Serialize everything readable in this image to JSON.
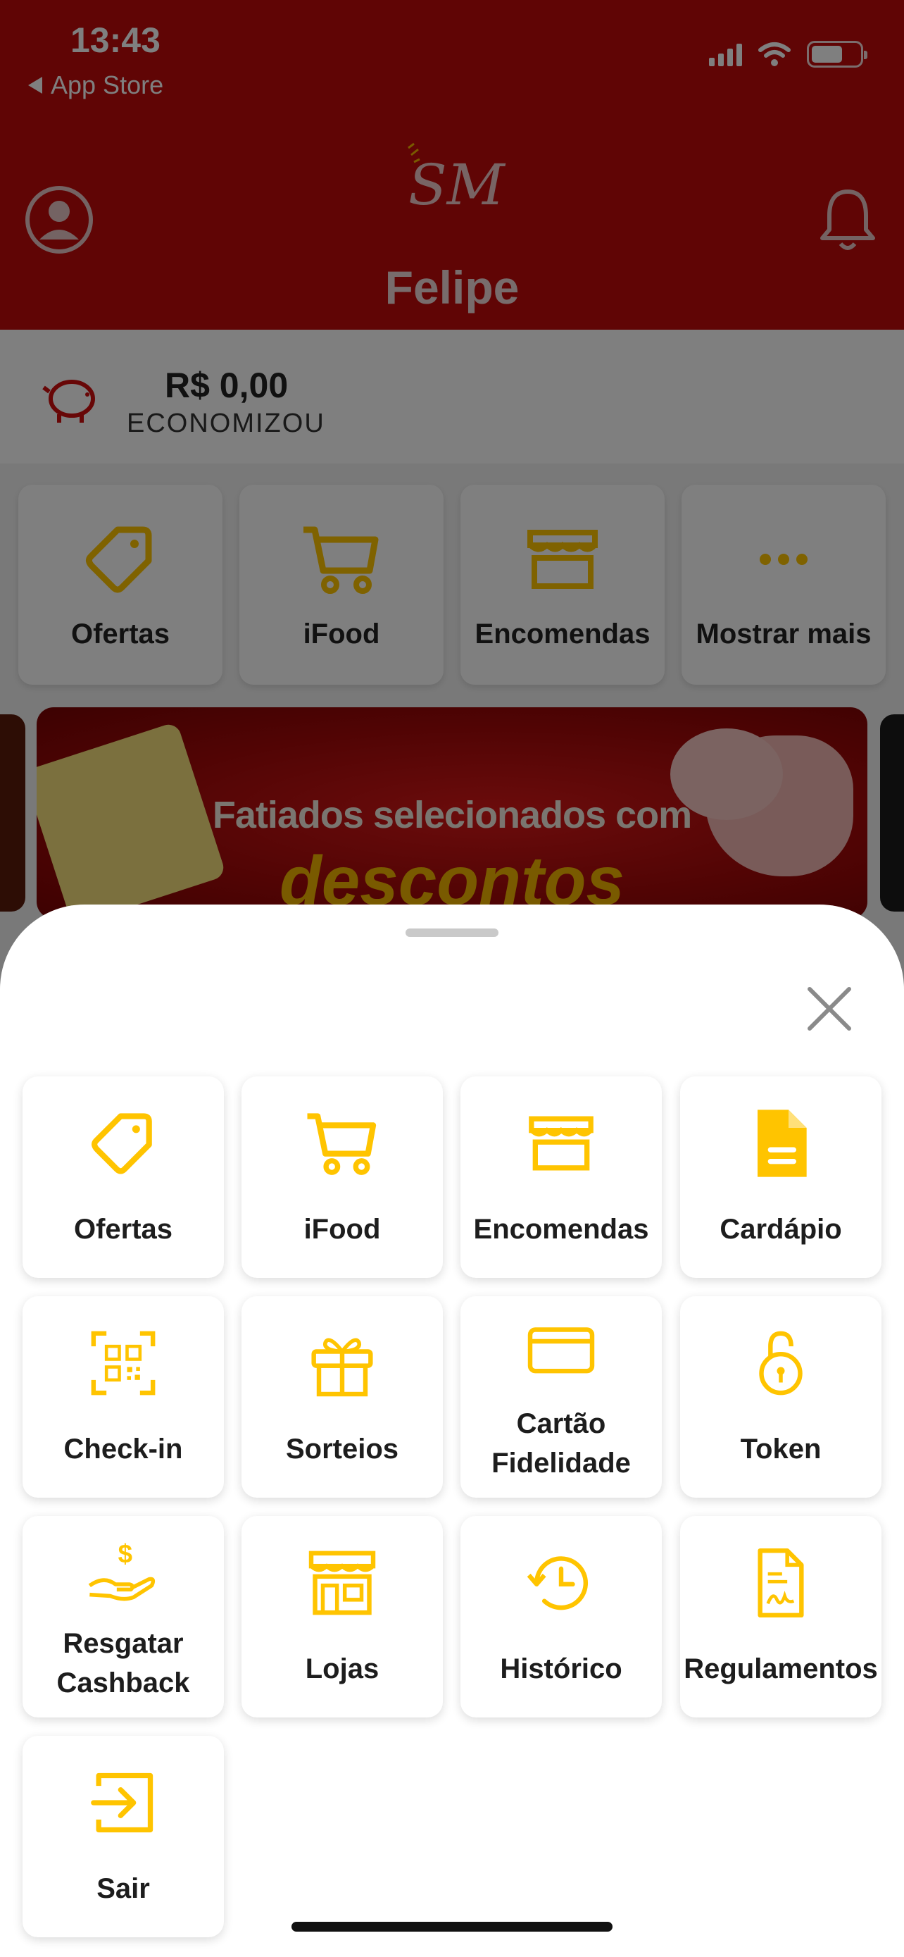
{
  "status_bar": {
    "time": "13:43",
    "back_label": "App Store"
  },
  "header": {
    "logo_text": "SM+",
    "greeting": "Felipe"
  },
  "savings": {
    "amount": "R$ 0,00",
    "caption": "ECONOMIZOU"
  },
  "quick_actions": [
    {
      "label": "Ofertas",
      "icon": "tag-icon"
    },
    {
      "label": "iFood",
      "icon": "cart-icon"
    },
    {
      "label": "Encomendas",
      "icon": "storefront-icon"
    },
    {
      "label": "Mostrar mais",
      "icon": "more-icon"
    }
  ],
  "banner": {
    "line1": "Fatiados selecionados com",
    "line2": "descontos"
  },
  "menu_sheet": {
    "items": [
      {
        "label": "Ofertas",
        "icon": "tag-icon"
      },
      {
        "label": "iFood",
        "icon": "cart-icon"
      },
      {
        "label": "Encomendas",
        "icon": "storefront-icon"
      },
      {
        "label": "Cardápio",
        "icon": "document-icon"
      },
      {
        "label": "Check-in",
        "icon": "qr-scan-icon"
      },
      {
        "label": "Sorteios",
        "icon": "gift-icon"
      },
      {
        "label": "Cartão Fidelidade",
        "label_lines": [
          "Cartão",
          "Fidelidade"
        ],
        "icon": "card-icon"
      },
      {
        "label": "Token",
        "icon": "unlock-icon"
      },
      {
        "label": "Resgatar Cashback",
        "label_lines": [
          "Resgatar",
          "Cashback"
        ],
        "icon": "cashback-hand-icon"
      },
      {
        "label": "Lojas",
        "icon": "store-icon"
      },
      {
        "label": "Histórico",
        "icon": "history-icon"
      },
      {
        "label": "Regulamentos",
        "icon": "contract-icon"
      },
      {
        "label": "Sair",
        "icon": "logout-icon"
      }
    ]
  },
  "colors": {
    "brand_red": "#c00a0a",
    "accent_yellow": "#ffc400",
    "overlay": "rgba(0,0,0,0.5)"
  }
}
